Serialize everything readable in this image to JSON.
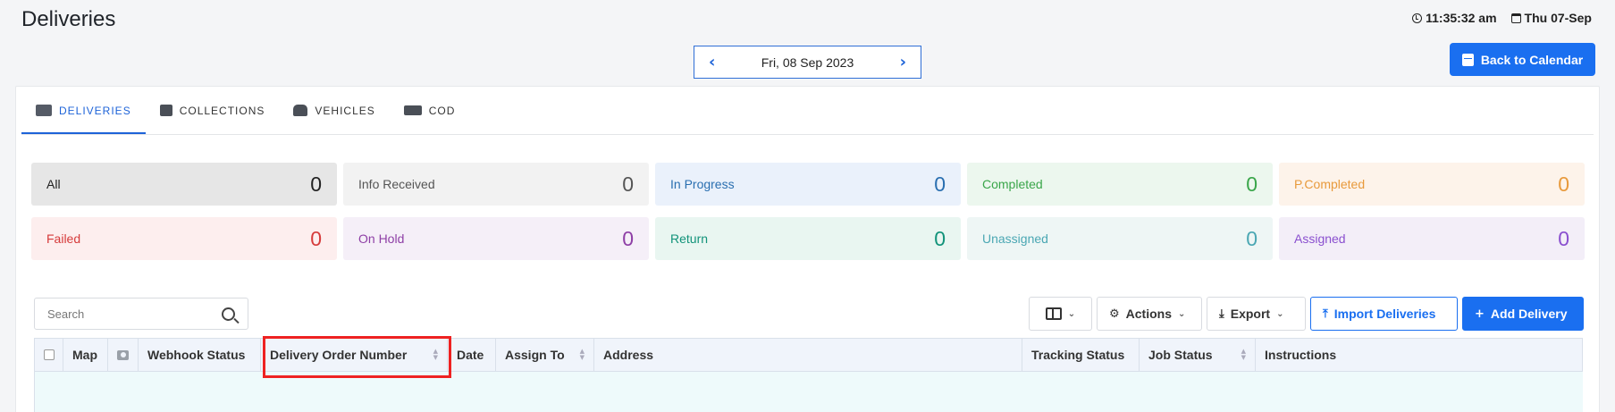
{
  "header": {
    "title": "Deliveries",
    "time": "11:35:32 am",
    "date": "Thu 07-Sep"
  },
  "datenav": {
    "date": "Fri, 08 Sep 2023",
    "prev_icon": "chevron-left-icon",
    "next_icon": "chevron-right-icon"
  },
  "back_button": {
    "label": "Back to Calendar",
    "icon": "calendar-icon"
  },
  "tabs": [
    {
      "label": "DELIVERIES",
      "icon": "truck-icon",
      "active": true
    },
    {
      "label": "COLLECTIONS",
      "icon": "box-icon",
      "active": false
    },
    {
      "label": "VEHICLES",
      "icon": "car-icon",
      "active": false
    },
    {
      "label": "COD",
      "icon": "cash-icon",
      "active": false
    }
  ],
  "statuses": [
    {
      "label": "All",
      "count": "0",
      "bg": "#e6e6e6",
      "color": "#222222"
    },
    {
      "label": "Info Received",
      "count": "0",
      "bg": "#f2f2f2",
      "color": "#555555"
    },
    {
      "label": "In Progress",
      "count": "0",
      "bg": "#eaf1fb",
      "color": "#2a6fb0"
    },
    {
      "label": "Completed",
      "count": "0",
      "bg": "#ecf7ee",
      "color": "#3aa64a"
    },
    {
      "label": "P.Completed",
      "count": "0",
      "bg": "#fdf3ea",
      "color": "#e89a3c"
    },
    {
      "label": "Failed",
      "count": "0",
      "bg": "#fdeeee",
      "color": "#d63b3b"
    },
    {
      "label": "On Hold",
      "count": "0",
      "bg": "#f5eff8",
      "color": "#8e3fa6"
    },
    {
      "label": "Return",
      "count": "0",
      "bg": "#e9f6f1",
      "color": "#12937a"
    },
    {
      "label": "Unassigned",
      "count": "0",
      "bg": "#eef6f5",
      "color": "#4aa7b3"
    },
    {
      "label": "Assigned",
      "count": "0",
      "bg": "#f3eef8",
      "color": "#8a4fcf"
    }
  ],
  "search": {
    "placeholder": "Search"
  },
  "toolbar": {
    "actions": "Actions",
    "export": "Export",
    "import": "Import Deliveries",
    "add": "Add Delivery"
  },
  "table": {
    "columns": [
      {
        "label": "",
        "key": "checkbox"
      },
      {
        "label": "Map"
      },
      {
        "label": "",
        "key": "photo"
      },
      {
        "label": "Webhook Status"
      },
      {
        "label": "Delivery Order Number",
        "sortable": true
      },
      {
        "label": "Date"
      },
      {
        "label": "Assign To",
        "sortable": true
      },
      {
        "label": "Address"
      },
      {
        "label": "Tracking Status"
      },
      {
        "label": "Job Status",
        "sortable": true
      },
      {
        "label": "Instructions"
      }
    ]
  }
}
